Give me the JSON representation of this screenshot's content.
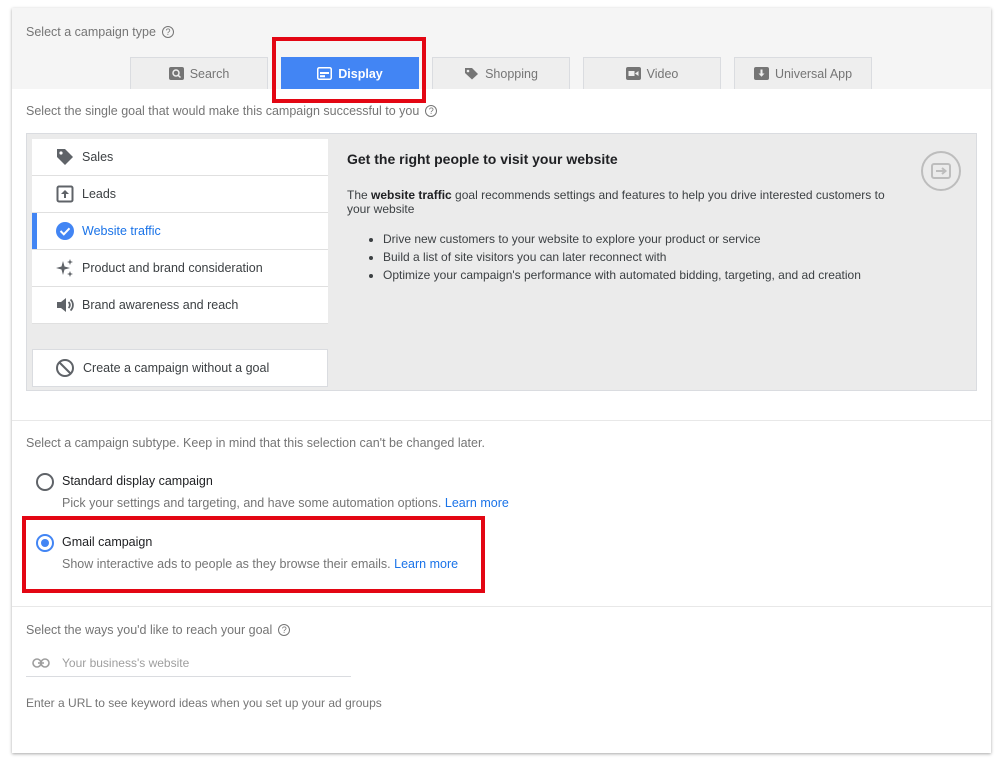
{
  "campaign_type": {
    "label": "Select a campaign type",
    "help": "?",
    "tabs": [
      {
        "label": "Search",
        "icon": "search-icon",
        "active": false
      },
      {
        "label": "Display",
        "icon": "display-icon",
        "active": true
      },
      {
        "label": "Shopping",
        "icon": "tag-icon",
        "active": false
      },
      {
        "label": "Video",
        "icon": "video-icon",
        "active": false
      },
      {
        "label": "Universal App",
        "icon": "download-icon",
        "active": false
      }
    ]
  },
  "goal": {
    "label": "Select the single goal that would make this campaign successful to you",
    "help": "?",
    "items": [
      {
        "label": "Sales",
        "icon": "tag-icon",
        "selected": false
      },
      {
        "label": "Leads",
        "icon": "leads-icon",
        "selected": false
      },
      {
        "label": "Website traffic",
        "icon": "check-circle-icon",
        "selected": true
      },
      {
        "label": "Product and brand consideration",
        "icon": "sparkle-icon",
        "selected": false
      },
      {
        "label": "Brand awareness and reach",
        "icon": "speaker-icon",
        "selected": false
      }
    ],
    "no_goal": {
      "label": "Create a campaign without a goal",
      "icon": "block-icon"
    },
    "detail": {
      "title": "Get the right people to visit your website",
      "intro_before": "The ",
      "intro_bold": "website traffic",
      "intro_after": " goal recommends settings and features to help you drive interested customers to your website",
      "bullets": [
        "Drive new customers to your website to explore your product or service",
        "Build a list of site visitors you can later reconnect with",
        "Optimize your campaign's performance with automated bidding, targeting, and ad creation"
      ],
      "icon": "exit-to-app-icon"
    }
  },
  "subtype": {
    "label": "Select a campaign subtype. Keep in mind that this selection can't be changed later.",
    "options": [
      {
        "title": "Standard display campaign",
        "desc": "Pick your settings and targeting, and have some automation options.",
        "link": "Learn more",
        "checked": false
      },
      {
        "title": "Gmail campaign",
        "desc": "Show interactive ads to people as they browse their emails.",
        "link": "Learn more",
        "checked": true
      }
    ]
  },
  "reach": {
    "label": "Select the ways you'd like to reach your goal",
    "help": "?",
    "url_placeholder": "Your business's website",
    "url_value": "",
    "hint": "Enter a URL to see keyword ideas when you set up your ad groups"
  },
  "colors": {
    "accent": "#4285f4",
    "highlight": "#e30613",
    "link": "#1a73e8"
  }
}
